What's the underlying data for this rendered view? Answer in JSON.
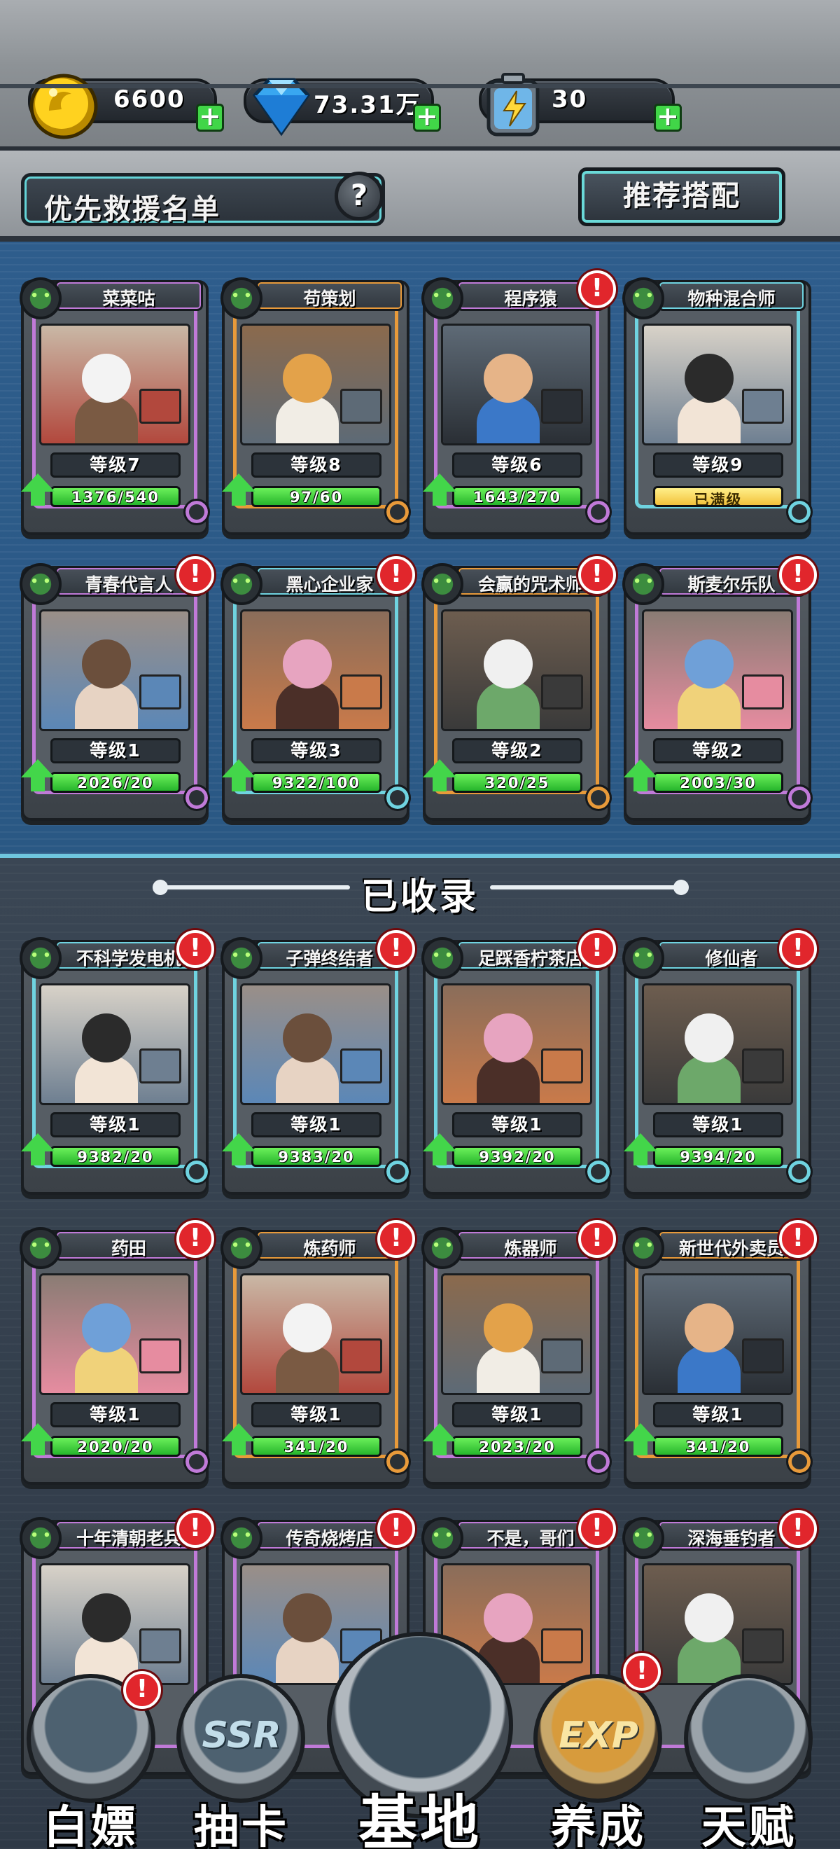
{
  "resources": {
    "coins": "6600",
    "diamonds": "73.31万",
    "energy": "30"
  },
  "header": {
    "rescue_list": "优先救援名单",
    "help": "?",
    "recommend": "推荐搭配"
  },
  "colors": {
    "purple_frame": "#c07ad8",
    "orange_frame": "#e89a3a",
    "cyan_frame": "#6fd3e0",
    "progress_green": "#43d64a",
    "alert_red": "#e1262c",
    "priority_bg": "#2e5d8c"
  },
  "priority_cards": [
    {
      "name": "菜菜咕",
      "level": "等级7",
      "progress": "1376/540",
      "frame": "purple",
      "alert": false,
      "full": false
    },
    {
      "name": "苟策划",
      "level": "等级8",
      "progress": "97/60",
      "frame": "orange",
      "alert": false,
      "full": false
    },
    {
      "name": "程序猿",
      "level": "等级6",
      "progress": "1643/270",
      "frame": "purple",
      "alert": true,
      "full": false
    },
    {
      "name": "物种混合师",
      "level": "等级9",
      "progress": "已满级",
      "frame": "cyan",
      "alert": false,
      "full": true
    },
    {
      "name": "青春代言人",
      "level": "等级1",
      "progress": "2026/20",
      "frame": "purple",
      "alert": true,
      "full": false
    },
    {
      "name": "黑心企业家",
      "level": "等级3",
      "progress": "9322/100",
      "frame": "cyan",
      "alert": true,
      "full": false
    },
    {
      "name": "会赢的咒术师",
      "level": "等级2",
      "progress": "320/25",
      "frame": "orange",
      "alert": true,
      "full": false
    },
    {
      "name": "斯麦尔乐队",
      "level": "等级2",
      "progress": "2003/30",
      "frame": "purple",
      "alert": true,
      "full": false
    }
  ],
  "collected_title": "已收录",
  "collected_cards": [
    {
      "name": "不科学发电机",
      "level": "等级1",
      "progress": "9382/20",
      "frame": "cyan",
      "alert": true,
      "full": false
    },
    {
      "name": "子弹终结者",
      "level": "等级1",
      "progress": "9383/20",
      "frame": "cyan",
      "alert": true,
      "full": false
    },
    {
      "name": "足踩香柠茶店",
      "level": "等级1",
      "progress": "9392/20",
      "frame": "cyan",
      "alert": true,
      "full": false
    },
    {
      "name": "修仙者",
      "level": "等级1",
      "progress": "9394/20",
      "frame": "cyan",
      "alert": true,
      "full": false
    },
    {
      "name": "药田",
      "level": "等级1",
      "progress": "2020/20",
      "frame": "purple",
      "alert": true,
      "full": false
    },
    {
      "name": "炼药师",
      "level": "等级1",
      "progress": "341/20",
      "frame": "orange",
      "alert": true,
      "full": false
    },
    {
      "name": "炼器师",
      "level": "等级1",
      "progress": "2023/20",
      "frame": "purple",
      "alert": true,
      "full": false
    },
    {
      "name": "新世代外卖员",
      "level": "等级1",
      "progress": "341/20",
      "frame": "orange",
      "alert": true,
      "full": false
    },
    {
      "name": "十年清朝老兵",
      "level": "",
      "progress": "",
      "frame": "purple",
      "alert": true,
      "full": false
    },
    {
      "name": "传奇烧烤店",
      "level": "",
      "progress": "",
      "frame": "purple",
      "alert": true,
      "full": false
    },
    {
      "name": "不是，哥们",
      "level": "",
      "progress": "",
      "frame": "purple",
      "alert": true,
      "full": false
    },
    {
      "name": "深海垂钓者",
      "level": "",
      "progress": "",
      "frame": "purple",
      "alert": true,
      "full": false
    }
  ],
  "nav": [
    {
      "label": "白嫖",
      "glyph": "",
      "alert": true
    },
    {
      "label": "抽卡",
      "glyph": "SSR",
      "alert": false
    },
    {
      "label": "基地",
      "glyph": "",
      "alert": false
    },
    {
      "label": "养成",
      "glyph": "EXP",
      "alert": true
    },
    {
      "label": "天赋",
      "glyph": "",
      "alert": false
    }
  ],
  "alert_mark": "!"
}
